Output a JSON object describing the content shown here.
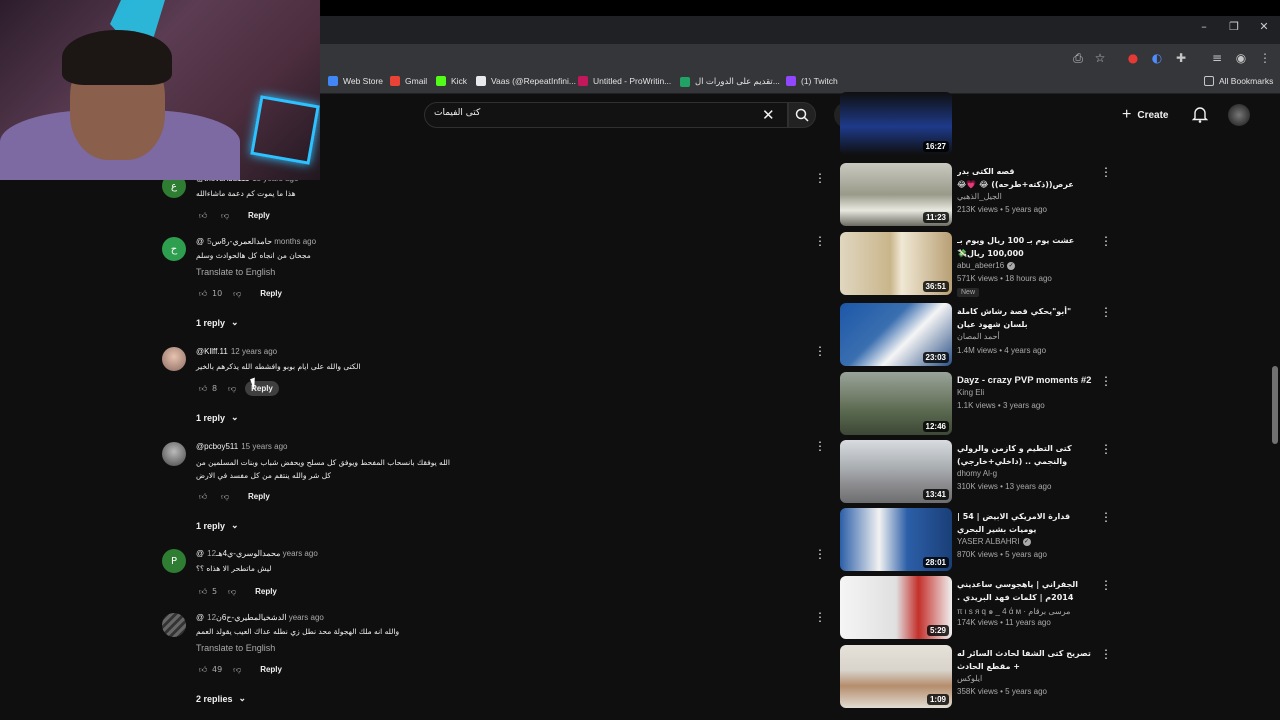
{
  "browser": {
    "bookmarks": [
      {
        "label": "Web Store",
        "color": "#4285f4"
      },
      {
        "label": "Gmail",
        "color": "#ea4335"
      },
      {
        "label": "Kick",
        "color": "#53fc18"
      },
      {
        "label": "Vaas (@RepeatInfini...",
        "color": "#e7e9ea"
      },
      {
        "label": "Untitled - ProWritin...",
        "color": "#c2185b"
      },
      {
        "label": "تقديم على الدورات ال...",
        "color": "#21a366"
      },
      {
        "label": "(1) Twitch",
        "color": "#9146ff"
      }
    ],
    "all_bookmarks": "All Bookmarks",
    "window_controls": {
      "minimize": "–",
      "restore": "❐",
      "close": "✕"
    }
  },
  "youtube": {
    "search_value": "كتى الفيمات",
    "create_label": "Create"
  },
  "comments": [
    {
      "author": "@thevandu111",
      "time": "15 years ago",
      "text": "هذا ما يموت كم دعمة ماشاءالله",
      "translate": "",
      "likes": "",
      "reply": "Reply",
      "replies": "",
      "avatar_letter": "ع",
      "avatar_color": "#2e7d32"
    },
    {
      "author": "@حامدالعمري-ر8س",
      "time": "5 months ago",
      "text": "مجحان من انجاه كل هالحوادث وسلم",
      "translate": "Translate to English",
      "likes": "10",
      "reply": "Reply",
      "replies": "1 reply",
      "avatar_letter": "ح",
      "avatar_color": "#2e9e4f"
    },
    {
      "author": "@Kllff.11",
      "time": "12 years ago",
      "text": "الكتى والله على ايام بوبو وافشطه الله يذكرهم بالخير",
      "translate": "",
      "likes": "8",
      "reply": "Reply",
      "replies": "1 reply",
      "avatar_letter": "",
      "avatar_color": "#b0b0b0"
    },
    {
      "author": "@pcboy511",
      "time": "15 years ago",
      "text": "الله يوفقك بانسحاب المفحط ويوفق كل مسلح ويحفض شباب وبنات المسلمين من كل شر والله ينتقم من كل مفسد في الارض",
      "translate": "",
      "likes": "",
      "reply": "Reply",
      "replies": "1 reply",
      "avatar_letter": "",
      "avatar_color": "#8a8a8a"
    },
    {
      "author": "@محمدالوسري-ي4هـ",
      "time": "12 years ago",
      "text": "ليش ماتطحر الا هذاه ؟؟",
      "translate": "",
      "likes": "5",
      "reply": "Reply",
      "replies": "",
      "avatar_letter": "P",
      "avatar_color": "#2e7d32"
    },
    {
      "author": "@الدشخيالمطيري-ح6ن",
      "time": "12 years ago",
      "text": "والله انه ملك الهجولة محد نطل زي نطله عداك العيب يقولد العمم",
      "translate": "Translate to English",
      "likes": "49",
      "reply": "Reply",
      "replies": "2 replies",
      "avatar_letter": "",
      "avatar_color": "#555555"
    }
  ],
  "videos": [
    {
      "title": "",
      "channel": "",
      "views": "",
      "age": "",
      "duration": "16:27",
      "verified": false,
      "badge": "",
      "thumb": "#1e3a8a"
    },
    {
      "title": "قصه الكتى بدر عرص((ذكته+طرحه)) 😂 💗😂",
      "channel": "الجيل_الذهبي",
      "views": "213K views",
      "age": "5 years ago",
      "duration": "11:23",
      "verified": false,
      "badge": "",
      "thumb": "#9a9a8a"
    },
    {
      "title": "عشت يوم بـ 100 ريال ويوم بـ 100,000 ريال💸",
      "channel": "abu_abeer16",
      "views": "571K views",
      "age": "18 hours ago",
      "duration": "36:51",
      "verified": true,
      "badge": "New",
      "thumb": "#c9b58a"
    },
    {
      "title": "\"أبو\"يحكي قصة رشاش كاملة بلسان شهود عيان #مسلسل_رشاش #رشاش و سعود",
      "channel": "أحمد المصان",
      "views": "1.4M views",
      "age": "4 years ago",
      "duration": "23:03",
      "verified": false,
      "badge": "",
      "thumb": "#3a6fb0"
    },
    {
      "title": "Dayz - crazy PVP moments #2",
      "channel": "King Eli",
      "views": "1.1K views",
      "age": "3 years ago",
      "duration": "12:46",
      "verified": false,
      "badge": "",
      "thumb": "#5c6b52"
    },
    {
      "title": "كتى التطيم و كازمن والرولي والنجمي .. (داخلي+خارجي)",
      "channel": "dhomy Al-g",
      "views": "310K views",
      "age": "13 years ago",
      "duration": "13:41",
      "verified": false,
      "badge": "",
      "thumb": "#8d8d90"
    },
    {
      "title": "قدارة الامريكي الابيض | 54 | يوميات بشير البحري",
      "channel": "YASER ALBAHRI",
      "views": "870K views",
      "age": "5 years ago",
      "duration": "28:01",
      "verified": true,
      "badge": "",
      "thumb": "#2c5fa8"
    },
    {
      "title": "الجفراني | ياهجوسي ساعديني 2014م | كلمات فهد البريدي .",
      "channel": "π ι s я q ๑ _ 4 ά м · مرسى برقام",
      "views": "174K views",
      "age": "11 years ago",
      "duration": "5:29",
      "verified": false,
      "badge": "",
      "thumb": "#e8e8e8"
    },
    {
      "title": "تصريح كتى الشفا لحادث السائر له + مقطع الحادث",
      "channel": "ايلوكس",
      "views": "358K views",
      "age": "5 years ago",
      "duration": "1:09",
      "verified": false,
      "badge": "",
      "thumb": "#d8d4cc"
    }
  ]
}
